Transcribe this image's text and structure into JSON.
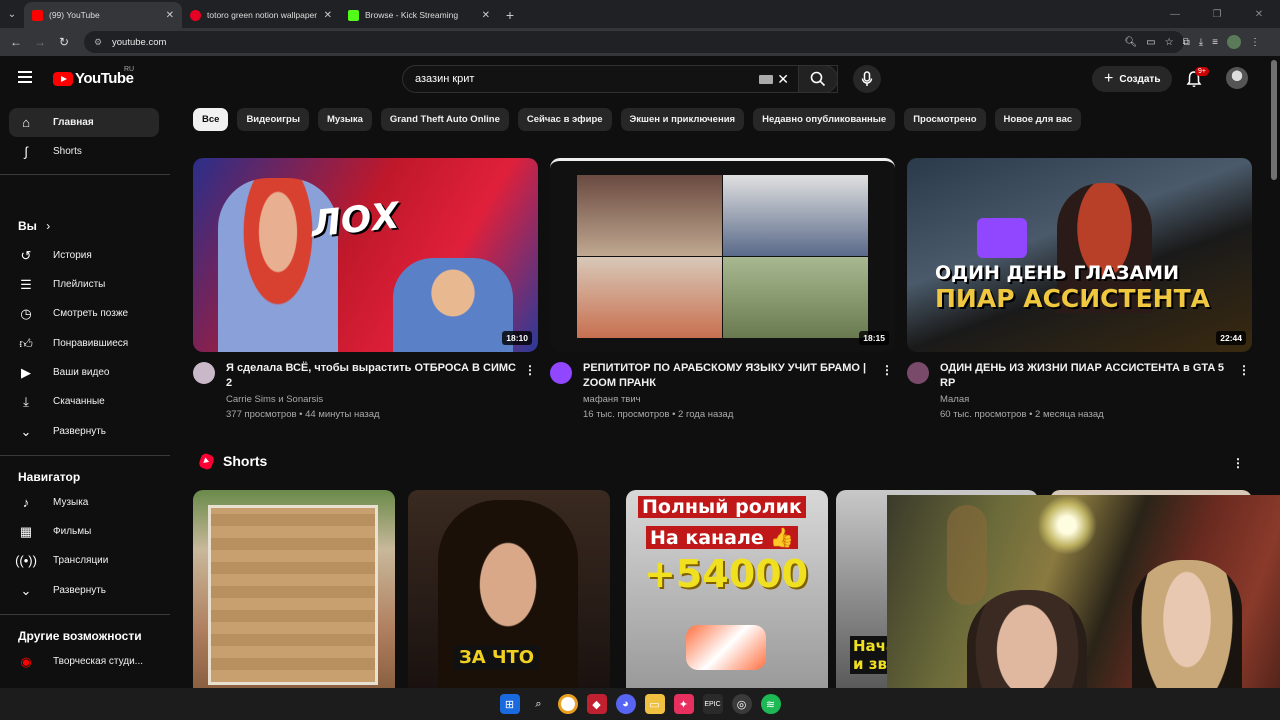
{
  "browser": {
    "tabs": [
      {
        "title": "(99) YouTube",
        "color": "#ff0000",
        "active": true
      },
      {
        "title": "totoro green notion wallpaper",
        "color": "#e60023",
        "active": false
      },
      {
        "title": "Browse - Kick Streaming",
        "color": "#53fc18",
        "active": false
      }
    ],
    "url": "youtube.com"
  },
  "header": {
    "logo_text": "YouTube",
    "region": "RU",
    "search_value": "азазин крит",
    "create_label": "Создать",
    "notifications_badge": "9+"
  },
  "sidebar": {
    "main": [
      {
        "label": "Главная",
        "icon": "home-icon",
        "active": true
      },
      {
        "label": "Shorts",
        "icon": "shorts-icon",
        "active": false
      }
    ],
    "you_header": "Вы",
    "you": [
      {
        "label": "История",
        "icon": "history-icon"
      },
      {
        "label": "Плейлисты",
        "icon": "playlists-icon"
      },
      {
        "label": "Смотреть позже",
        "icon": "clock-icon"
      },
      {
        "label": "Понравившиеся",
        "icon": "thumbs-up-icon"
      },
      {
        "label": "Ваши видео",
        "icon": "your-videos-icon"
      },
      {
        "label": "Скачанные",
        "icon": "download-icon"
      },
      {
        "label": "Развернуть",
        "icon": "chevron-down-icon"
      }
    ],
    "nav_header": "Навигатор",
    "nav": [
      {
        "label": "Музыка",
        "icon": "music-icon"
      },
      {
        "label": "Фильмы",
        "icon": "film-icon"
      },
      {
        "label": "Трансляции",
        "icon": "live-icon"
      },
      {
        "label": "Развернуть",
        "icon": "chevron-down-icon"
      }
    ],
    "more_header": "Другие возможности",
    "more": [
      {
        "label": "Творческая студи...",
        "icon": "studio-icon"
      }
    ]
  },
  "chips": [
    "Все",
    "Видеоигры",
    "Музыка",
    "Grand Theft Auto Online",
    "Сейчас в эфире",
    "Экшен и приключения",
    "Недавно опубликованные",
    "Просмотрено",
    "Новое для вас"
  ],
  "videos": [
    {
      "title": "Я сделала ВСЁ, чтобы вырастить ОТБРОСА В СИМС 2",
      "channel": "Carrie Sims и Sonarsis",
      "stats": "377 просмотров • 44 минуты назад",
      "duration": "18:10",
      "thumb_text": "ЛОХ"
    },
    {
      "title": "РЕПИТИТОР ПО АРАБСКОМУ ЯЗЫКУ УЧИТ БРАМО | ZOOM ПРАНК",
      "channel": "мафаня твич",
      "stats": "16 тыс. просмотров • 2 года назад",
      "duration": "18:15"
    },
    {
      "title": "ОДИН ДЕНЬ ИЗ ЖИЗНИ ПИАР АССИСТЕНТА в GTA 5 RP",
      "channel": "Малая",
      "stats": "60 тыс. просмотров • 2 месяца назад",
      "duration": "22:44",
      "thumb_text_1": "ОДИН ДЕНЬ ГЛАЗАМИ",
      "thumb_text_2": "ПИАР АССИСТЕНТА"
    }
  ],
  "shorts": {
    "title": "Shorts",
    "items": [
      {
        "overlay": ""
      },
      {
        "overlay": "ЗА ЧТО"
      },
      {
        "overlay_1": "Полный ролик",
        "overlay_2": "На канале 👍",
        "overlay_3": "+54000"
      },
      {
        "overlay": "Нача и зв"
      }
    ]
  }
}
